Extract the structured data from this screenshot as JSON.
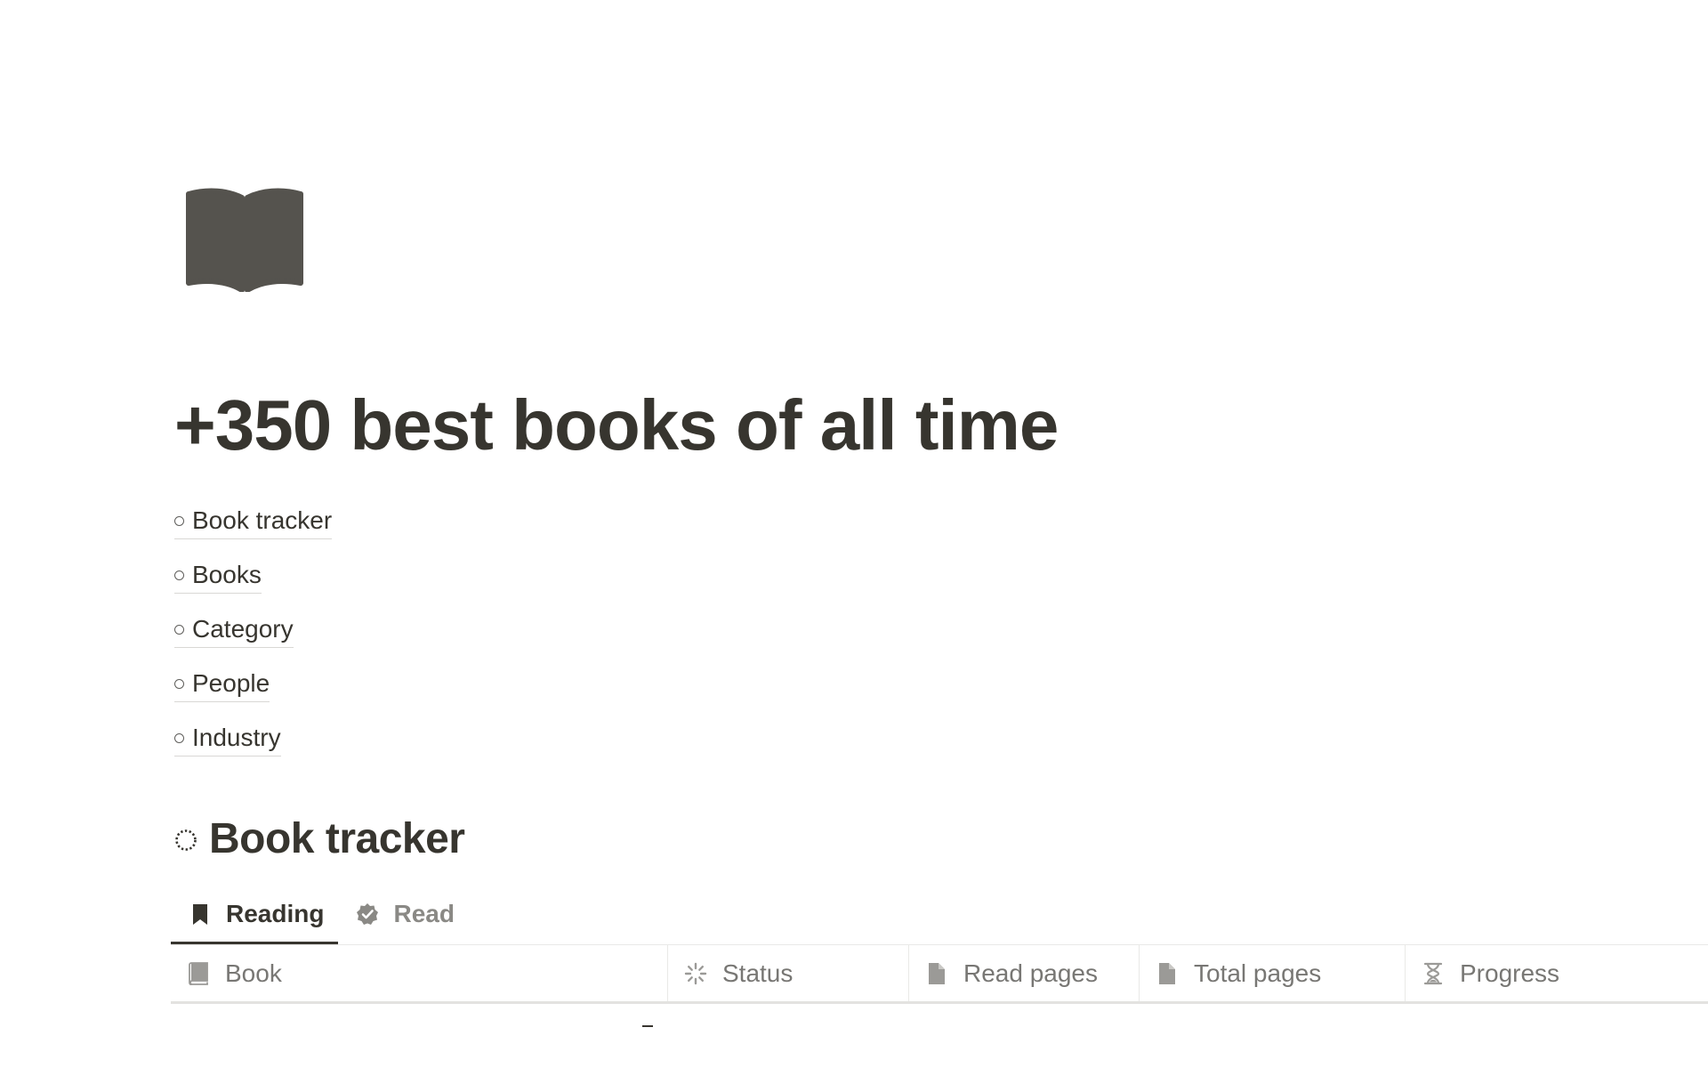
{
  "page": {
    "icon": "open-book-icon",
    "title": "+350 best books of all time"
  },
  "toc": {
    "items": [
      {
        "label": "Book tracker"
      },
      {
        "label": "Books"
      },
      {
        "label": "Category"
      },
      {
        "label": "People"
      },
      {
        "label": "Industry"
      }
    ]
  },
  "section": {
    "icon": "dashed-circle-icon",
    "title": "Book tracker"
  },
  "tabs": [
    {
      "label": "Reading",
      "icon": "bookmark-icon",
      "active": true
    },
    {
      "label": "Read",
      "icon": "verified-badge-icon",
      "active": false
    }
  ],
  "table": {
    "columns": [
      {
        "label": "Book",
        "icon": "book-icon"
      },
      {
        "label": "Status",
        "icon": "loading-spinner-icon"
      },
      {
        "label": "Read pages",
        "icon": "page-icon"
      },
      {
        "label": "Total pages",
        "icon": "page-icon"
      },
      {
        "label": "Progress",
        "icon": "hourglass-icon"
      }
    ]
  },
  "colors": {
    "text": "#37352f",
    "muted": "#787774",
    "icon": "#55534e",
    "divider": "#e9e9e7"
  }
}
